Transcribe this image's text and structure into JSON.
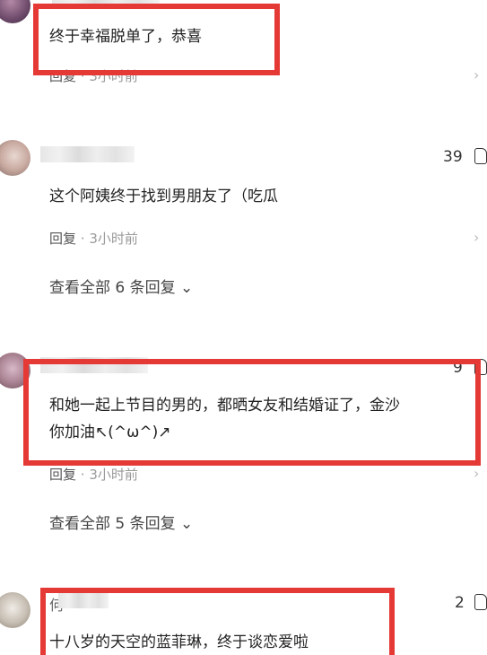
{
  "comments": [
    {
      "username": "",
      "text": "终于幸福脱单了，恭喜",
      "reply_label": "回复",
      "time": "3小时前"
    },
    {
      "likes": "39",
      "text": "这个阿姨终于找到男朋友了（吃瓜",
      "reply_label": "回复",
      "time": "3小时前",
      "view_all": "查看全部 6 条回复"
    },
    {
      "likes": "9",
      "text_line1": "和她一起上节目的男的，都晒女友和结婚证了，金沙",
      "text_line2": "你加油↖(^ω^)↗",
      "reply_label": "回复",
      "time": "3小时前",
      "view_all": "查看全部 5 条回复"
    },
    {
      "likes": "2",
      "username": "何",
      "text": "十八岁的天空的蓝菲琳，终于谈恋爱啦"
    }
  ],
  "separator": "·",
  "icons": {
    "like": "thumbs-up-icon",
    "chevron": "chevron-down-icon",
    "more": "chevron-right-icon"
  },
  "colors": {
    "highlight": "#e53935",
    "meta": "#9a9a9a"
  }
}
